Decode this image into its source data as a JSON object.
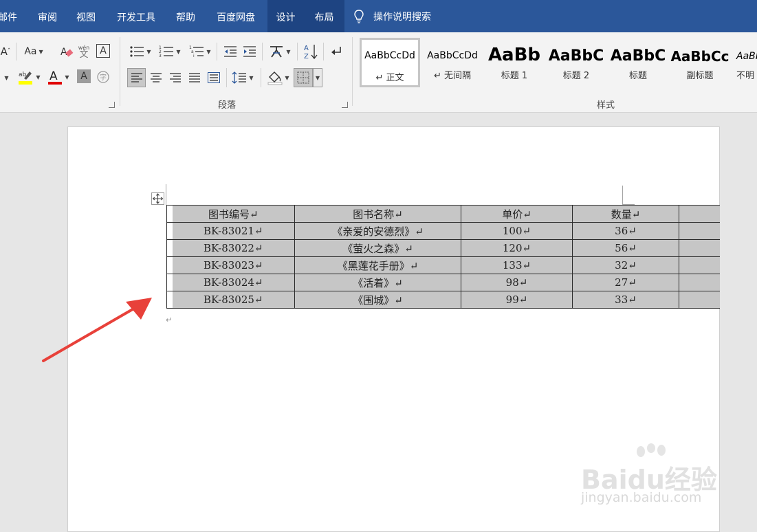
{
  "menu": {
    "items": [
      {
        "label": "邮件"
      },
      {
        "label": "审阅"
      },
      {
        "label": "视图"
      },
      {
        "label": "开发工具"
      },
      {
        "label": "帮助"
      },
      {
        "label": "百度网盘"
      },
      {
        "label": "设计"
      },
      {
        "label": "布局"
      }
    ],
    "active": "设计",
    "tell_me": "操作说明搜索"
  },
  "ribbon": {
    "font_group": {
      "case_label": "Aa",
      "phonetic_label": "wén",
      "font_color": "#e00000",
      "highlight_color": "#ffff00"
    },
    "paragraph_label": "段落",
    "styles_label": "样式",
    "styles": [
      {
        "preview": "AaBbCcDd",
        "name": "↵ 正文"
      },
      {
        "preview": "AaBbCcDd",
        "name": "↵ 无间隔"
      },
      {
        "preview": "AaBb",
        "name": "标题 1"
      },
      {
        "preview": "AaBbC",
        "name": "标题 2"
      },
      {
        "preview": "AaBbC",
        "name": "标题"
      },
      {
        "preview": "AaBbCc",
        "name": "副标题"
      },
      {
        "preview": "AaBbC",
        "name": "不明"
      }
    ]
  },
  "table": {
    "headers": [
      "图书编号↵",
      "图书名称↵",
      "单价↵",
      "数量↵"
    ],
    "rows": [
      [
        "BK-83021↵",
        "《亲爱的安德烈》↵",
        "100↵",
        "36↵"
      ],
      [
        "BK-83022↵",
        "《萤火之森》↵",
        "120↵",
        "56↵"
      ],
      [
        "BK-83023↵",
        "《黑莲花手册》↵",
        "133↵",
        "32↵"
      ],
      [
        "BK-83024↵",
        "《活着》↵",
        "98↵",
        "27↵"
      ],
      [
        "BK-83025↵",
        "《围城》↵",
        "99↵",
        "33↵"
      ]
    ]
  },
  "document": {
    "trailing_mark": "↵"
  },
  "annotation": {
    "arrow_color": "#e8413a"
  },
  "watermark": {
    "brand": "Baidu经验",
    "url": "jingyan.baidu.com"
  },
  "colors": {
    "titlebar": "#2b579a",
    "ribbon": "#f3f3f3",
    "workspace": "#e6e6e6",
    "table_shading": "#c6c6c6"
  }
}
